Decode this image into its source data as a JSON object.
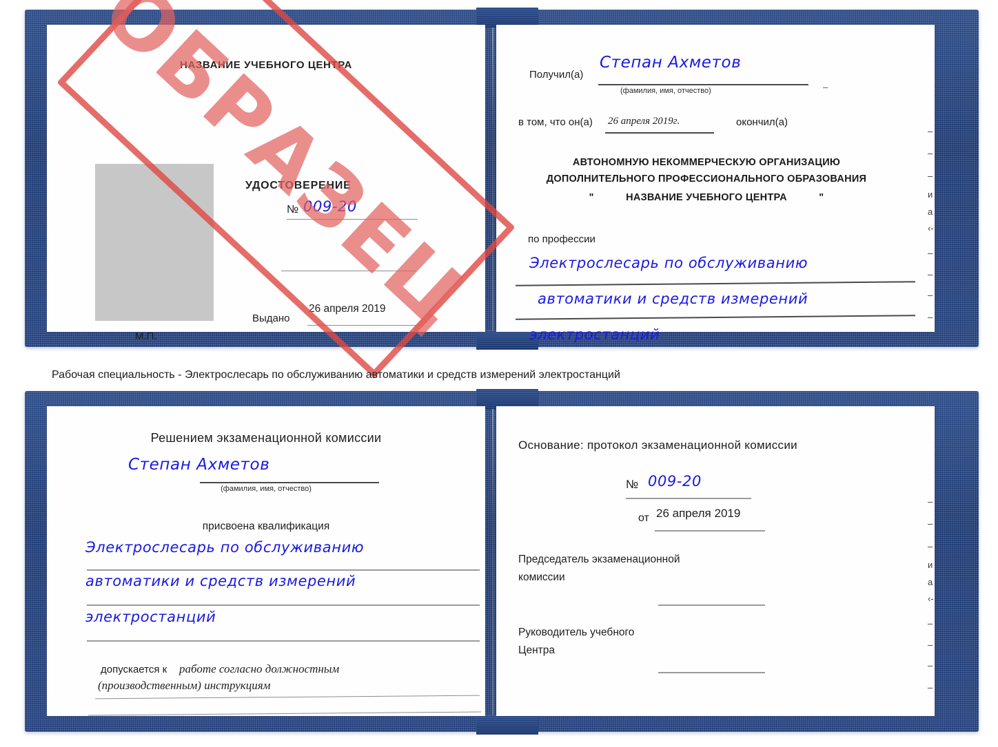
{
  "doc_top": {
    "left_page": {
      "center_name": "НАЗВАНИЕ УЧЕБНОГО ЦЕНТРА",
      "doc_type": "УДОСТОВЕРЕНИЕ",
      "number_symbol": "№",
      "number_value": "009-20",
      "issued_label": "Выдано",
      "issued_value": "26 апреля 2019",
      "seal_label": "М.П."
    },
    "right_page": {
      "received_label": "Получил(а)",
      "received_value": "Степан Ахметов",
      "fio_hint": "(фамилия, имя, отчество)",
      "in_that_label": "в том, что он(а)",
      "in_that_value": "26 апреля 2019г.",
      "finished_label": "окончил(а)",
      "org_line1": "АВТОНОМНУЮ НЕКОММЕРЧЕСКУЮ ОРГАНИЗАЦИЮ",
      "org_line2": "ДОПОЛНИТЕЛЬНОГО ПРОФЕССИОНАЛЬНОГО ОБРАЗОВАНИЯ",
      "org_quote_open": "\"",
      "org_line3": "НАЗВАНИЕ УЧЕБНОГО ЦЕНТРА",
      "org_quote_close": "\"",
      "profession_label": "по профессии",
      "profession_line1": "Электрослесарь по обслуживанию",
      "profession_line2": "автоматики и средств измерений",
      "profession_line3": "электростанций"
    },
    "edge_fragments": [
      "–",
      "–",
      "–",
      "и",
      "а",
      "‹-",
      "–",
      "–",
      "–",
      "–"
    ]
  },
  "caption": "Рабочая специальность - Электрослесарь по обслуживанию автоматики и средств измерений электростанций",
  "doc_bottom": {
    "left_page": {
      "commission_title": "Решением экзаменационной комиссии",
      "name_value": "Степан Ахметов",
      "fio_hint": "(фамилия, имя, отчество)",
      "qualification_label": "присвоена квалификация",
      "qualification_line1": "Электрослесарь по обслуживанию",
      "qualification_line2": "автоматики и средств измерений",
      "qualification_line3": "электростанций",
      "admitted_label": "допускается к",
      "admitted_value_line1": "работе согласно должностным",
      "admitted_value_line2": "(производственным) инструкциям"
    },
    "right_page": {
      "basis_label": "Основание: протокол экзаменационной комиссии",
      "number_symbol": "№",
      "number_value": "009-20",
      "date_prefix": "от",
      "date_value": "26 апреля 2019",
      "chairman_line1": "Председатель экзаменационной",
      "chairman_line2": "комиссии",
      "head_line1": "Руководитель учебного",
      "head_line2": "Центра"
    },
    "edge_fragments": [
      "–",
      "–",
      "–",
      "и",
      "а",
      "‹-",
      "–",
      "–",
      "–",
      "–"
    ]
  },
  "stamp": {
    "text": "ОБРАЗЕЦ",
    "color": "#df4844"
  },
  "palette": {
    "cover_blue": "#1e3a72",
    "handwriting_blue": "#1a1ae0",
    "stamp_red": "#df4844",
    "photo_gray": "#c7c7c7"
  }
}
